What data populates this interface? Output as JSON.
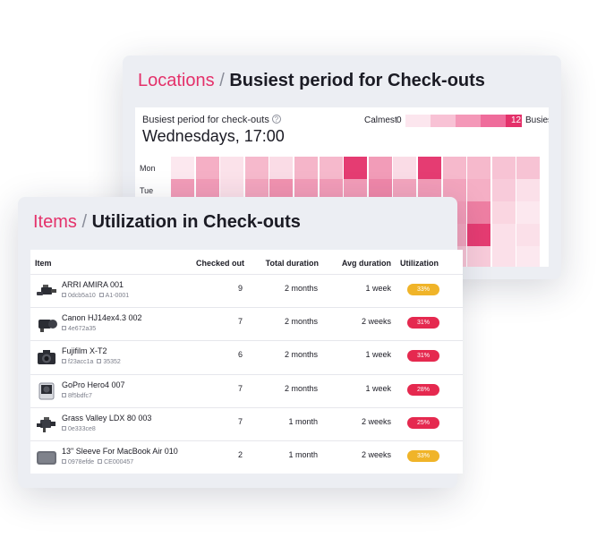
{
  "locations_card": {
    "crumb": "Locations",
    "separator": "/",
    "title": "Busiest period for Check-outs",
    "subtitle": "Busiest period for check-outs",
    "help_icon": "?",
    "busiest_value": "Wednesdays, 17:00",
    "legend": {
      "low_label": "Calmest",
      "low_value": "0",
      "high_value": "12",
      "high_label": "Busiest",
      "swatches": [
        "#fce6ee",
        "#f8c2d5",
        "#f498b8",
        "#ef6c9b",
        "#e4316a"
      ]
    },
    "heatmap": {
      "rows": [
        {
          "day": "Mon",
          "levels": [
            0.05,
            0.35,
            0.08,
            0.3,
            0.12,
            0.32,
            0.3,
            0.95,
            0.45,
            0.12,
            0.95,
            0.3,
            0.3,
            0.25,
            0.25
          ]
        },
        {
          "day": "Tue",
          "levels": [
            0.45,
            0.45,
            0.1,
            0.4,
            0.5,
            0.45,
            0.45,
            0.45,
            0.55,
            0.4,
            0.45,
            0.4,
            0.35,
            0.2,
            0.1
          ]
        },
        {
          "day": "",
          "levels": [
            0.2,
            0.3,
            0.25,
            0.4,
            0.35,
            0.3,
            0.4,
            0.35,
            0.5,
            0.45,
            0.55,
            0.45,
            0.6,
            0.15,
            0.05
          ]
        },
        {
          "day": "",
          "levels": [
            0.3,
            0.3,
            0.35,
            0.3,
            0.4,
            0.45,
            0.5,
            0.6,
            0.65,
            0.55,
            0.85,
            0.4,
            0.95,
            0.1,
            0.1
          ]
        },
        {
          "day": "",
          "levels": [
            0.25,
            0.3,
            0.2,
            0.35,
            0.3,
            0.4,
            0.3,
            0.35,
            0.4,
            0.45,
            0.35,
            0.25,
            0.2,
            0.1,
            0.05
          ]
        }
      ]
    }
  },
  "items_card": {
    "crumb": "Items",
    "separator": "/",
    "title": "Utilization in Check-outs",
    "columns": {
      "item": "Item",
      "checked_out": "Checked out",
      "total_duration": "Total duration",
      "avg_duration": "Avg duration",
      "utilization": "Utilization"
    },
    "rows": [
      {
        "name": "ARRI AMIRA 001",
        "id1": "0dcb5a10",
        "id2": "A1-0001",
        "icon": "cinema-camera-icon",
        "checked_out": "9",
        "total": "2 months",
        "avg": "1 week",
        "utilization": "33%",
        "color": "#f0b429"
      },
      {
        "name": "Canon HJ14ex4.3 002",
        "id1": "4e672a35",
        "id2": "",
        "icon": "broadcast-lens-icon",
        "checked_out": "7",
        "total": "2 months",
        "avg": "2 weeks",
        "utilization": "31%",
        "color": "#e5294f"
      },
      {
        "name": "Fujifilm X-T2",
        "id1": "f23acc1a",
        "id2": "35352",
        "icon": "mirrorless-camera-icon",
        "checked_out": "6",
        "total": "2 months",
        "avg": "1 week",
        "utilization": "31%",
        "color": "#e5294f"
      },
      {
        "name": "GoPro Hero4 007",
        "id1": "8f5bdfc7",
        "id2": "",
        "icon": "action-camera-icon",
        "checked_out": "7",
        "total": "2 months",
        "avg": "1 week",
        "utilization": "28%",
        "color": "#e5294f"
      },
      {
        "name": "Grass Valley LDX 80 003",
        "id1": "0e333ce8",
        "id2": "",
        "icon": "studio-camera-icon",
        "checked_out": "7",
        "total": "1 month",
        "avg": "2 weeks",
        "utilization": "25%",
        "color": "#e5294f"
      },
      {
        "name": "13\" Sleeve For MacBook Air 010",
        "id1": "0978efde",
        "id2": "CE000457",
        "icon": "laptop-sleeve-icon",
        "checked_out": "2",
        "total": "1 month",
        "avg": "2 weeks",
        "utilization": "33%",
        "color": "#f0b429"
      }
    ]
  }
}
